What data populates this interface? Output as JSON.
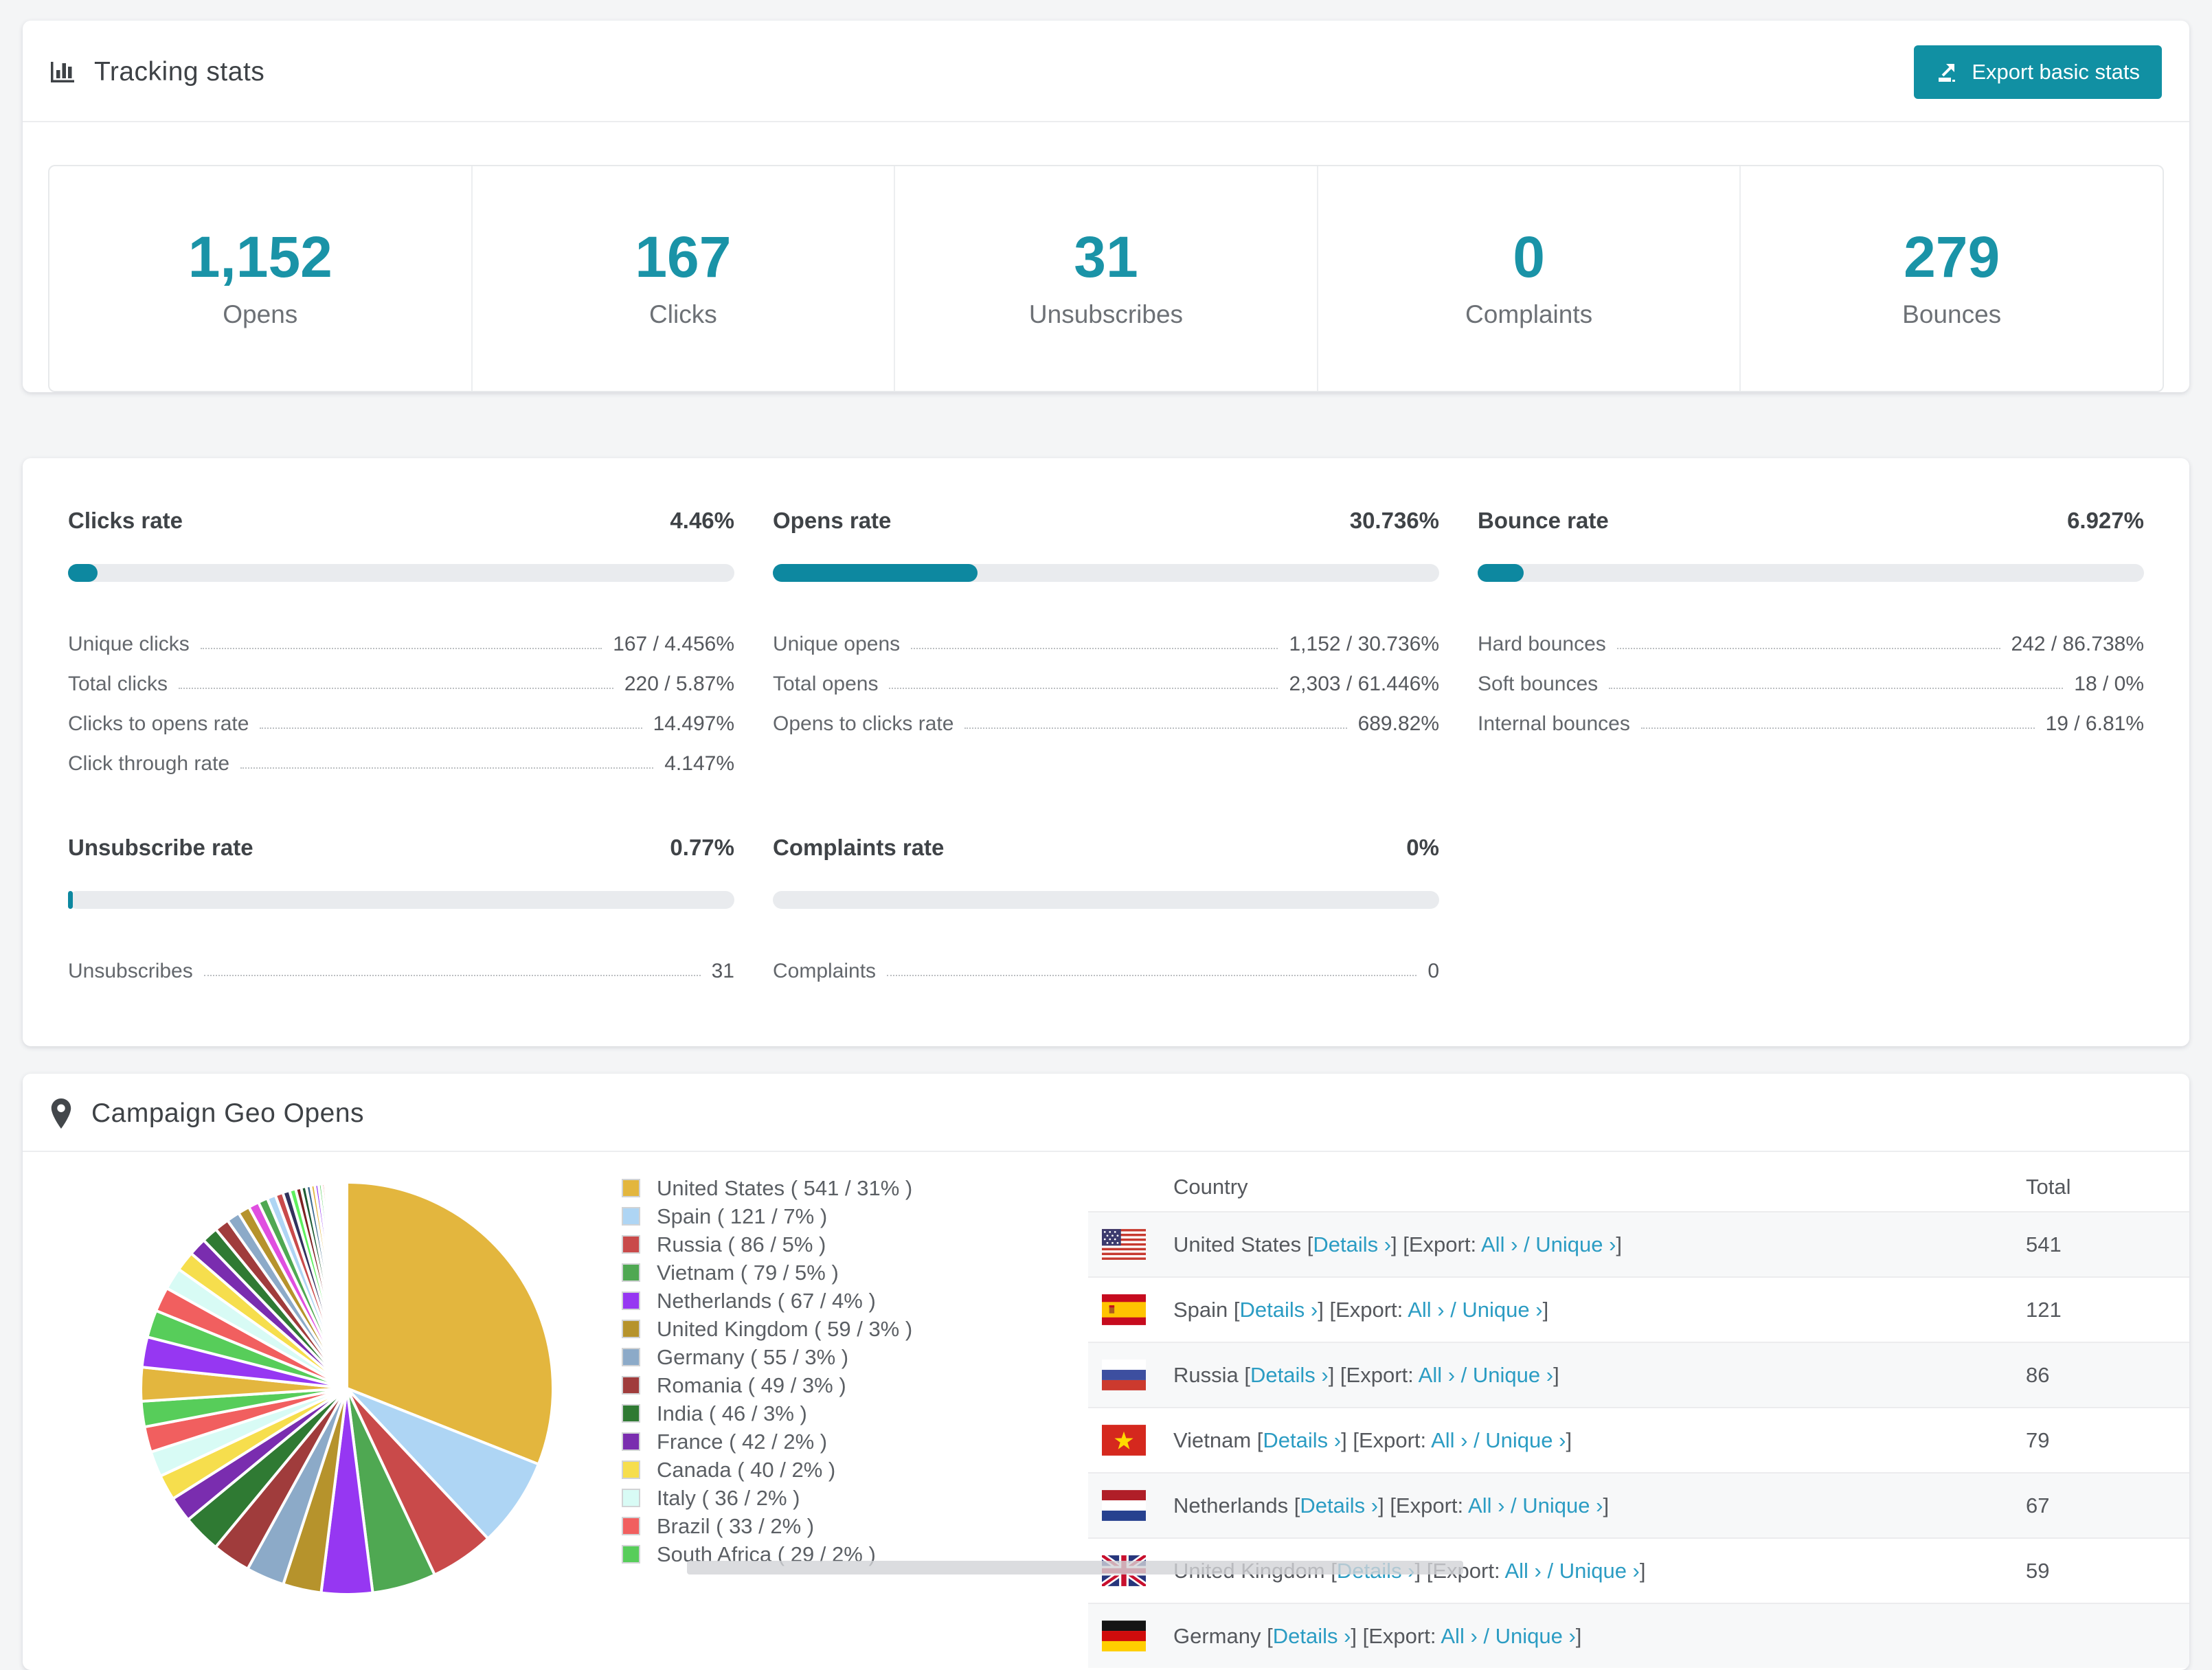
{
  "colors": {
    "teal_accent": "#1a93a7",
    "teal_button": "#1190a3",
    "teal_bar": "#0d88a0",
    "link": "#2b9cc3",
    "page_bg": "#f4f5f6"
  },
  "tracking": {
    "title": "Tracking stats",
    "export_button_label": "Export basic stats",
    "stats": [
      {
        "value": "1,152",
        "label": "Opens"
      },
      {
        "value": "167",
        "label": "Clicks"
      },
      {
        "value": "31",
        "label": "Unsubscribes"
      },
      {
        "value": "0",
        "label": "Complaints"
      },
      {
        "value": "279",
        "label": "Bounces"
      }
    ]
  },
  "rates": {
    "blocks": [
      {
        "title": "Clicks rate",
        "value": "4.46%",
        "pct": 4.46,
        "rows": [
          {
            "label": "Unique clicks",
            "value": "167 / 4.456%"
          },
          {
            "label": "Total clicks",
            "value": "220 / 5.87%"
          },
          {
            "label": "Clicks to opens rate",
            "value": "14.497%"
          },
          {
            "label": "Click through rate",
            "value": "4.147%"
          }
        ]
      },
      {
        "title": "Opens rate",
        "value": "30.736%",
        "pct": 30.736,
        "rows": [
          {
            "label": "Unique opens",
            "value": "1,152 / 30.736%"
          },
          {
            "label": "Total opens",
            "value": "2,303 / 61.446%"
          },
          {
            "label": "Opens to clicks rate",
            "value": "689.82%"
          }
        ]
      },
      {
        "title": "Bounce rate",
        "value": "6.927%",
        "pct": 6.927,
        "rows": [
          {
            "label": "Hard bounces",
            "value": "242 / 86.738%"
          },
          {
            "label": "Soft bounces",
            "value": "18 / 0%"
          },
          {
            "label": "Internal bounces",
            "value": "19 / 6.81%"
          }
        ]
      },
      {
        "title": "Unsubscribe rate",
        "value": "0.77%",
        "pct": 0.77,
        "rows": [
          {
            "label": "Unsubscribes",
            "value": "31"
          }
        ]
      },
      {
        "title": "Complaints rate",
        "value": "0%",
        "pct": 0,
        "rows": [
          {
            "label": "Complaints",
            "value": "0"
          }
        ]
      }
    ]
  },
  "geo": {
    "title": "Campaign Geo Opens",
    "table": {
      "headers": [
        "Country",
        "Total"
      ],
      "details_label": "Details ›",
      "export_label": "Export:",
      "all_label": "All ›",
      "unique_label": "Unique ›",
      "rows": [
        {
          "country": "United States",
          "flag": "us",
          "total": "541"
        },
        {
          "country": "Spain",
          "flag": "es",
          "total": "121"
        },
        {
          "country": "Russia",
          "flag": "ru",
          "total": "86"
        },
        {
          "country": "Vietnam",
          "flag": "vn",
          "total": "79"
        },
        {
          "country": "Netherlands",
          "flag": "nl",
          "total": "67"
        },
        {
          "country": "United Kingdom",
          "flag": "gb",
          "total": "59"
        },
        {
          "country": "Germany",
          "flag": "de",
          "total": ""
        }
      ]
    }
  },
  "chart_data": {
    "type": "pie",
    "title": "Campaign Geo Opens",
    "unit": "opens",
    "legend_position": "right",
    "start_angle_deg": -90,
    "direction": "clockwise",
    "series": [
      {
        "label": "United States",
        "value": 541,
        "pct": 31,
        "color": "#e3b63e"
      },
      {
        "label": "Spain",
        "value": 121,
        "pct": 7,
        "color": "#aed5f4"
      },
      {
        "label": "Russia",
        "value": 86,
        "pct": 5,
        "color": "#c94a4a"
      },
      {
        "label": "Vietnam",
        "value": 79,
        "pct": 5,
        "color": "#4fa852"
      },
      {
        "label": "Netherlands",
        "value": 67,
        "pct": 4,
        "color": "#9637f2"
      },
      {
        "label": "United Kingdom",
        "value": 59,
        "pct": 3,
        "color": "#b6932c"
      },
      {
        "label": "Germany",
        "value": 55,
        "pct": 3,
        "color": "#8caac8"
      },
      {
        "label": "Romania",
        "value": 49,
        "pct": 3,
        "color": "#a03c3c"
      },
      {
        "label": "India",
        "value": 46,
        "pct": 3,
        "color": "#2f7a33"
      },
      {
        "label": "France",
        "value": 42,
        "pct": 2,
        "color": "#7a2daf"
      },
      {
        "label": "Canada",
        "value": 40,
        "pct": 2,
        "color": "#f6de4d"
      },
      {
        "label": "Italy",
        "value": 36,
        "pct": 2,
        "color": "#d8fbf5"
      },
      {
        "label": "Brazil",
        "value": 33,
        "pct": 2,
        "color": "#f15f5f"
      },
      {
        "label": "South Africa",
        "value": 29,
        "pct": 2,
        "color": "#57cd5a"
      }
    ],
    "others_unlabeled": {
      "total_pct": 26,
      "visible_slice_count": 40
    }
  }
}
